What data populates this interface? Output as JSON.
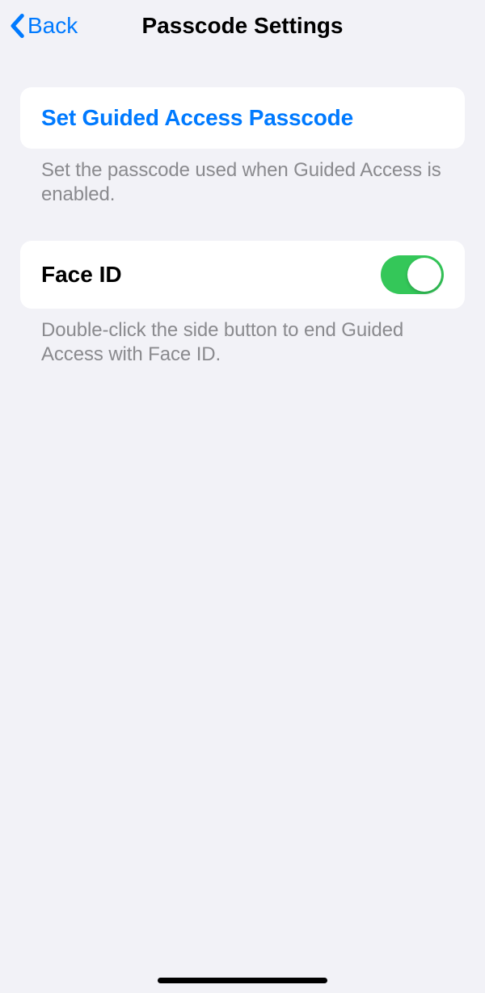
{
  "nav": {
    "back_label": "Back",
    "title": "Passcode Settings"
  },
  "sections": {
    "set_passcode": {
      "link_label": "Set Guided Access Passcode",
      "footer": "Set the passcode used when Guided Access is enabled."
    },
    "face_id": {
      "label": "Face ID",
      "toggle_on": true,
      "footer": "Double-click the side button to end Guided Access with Face ID."
    }
  }
}
